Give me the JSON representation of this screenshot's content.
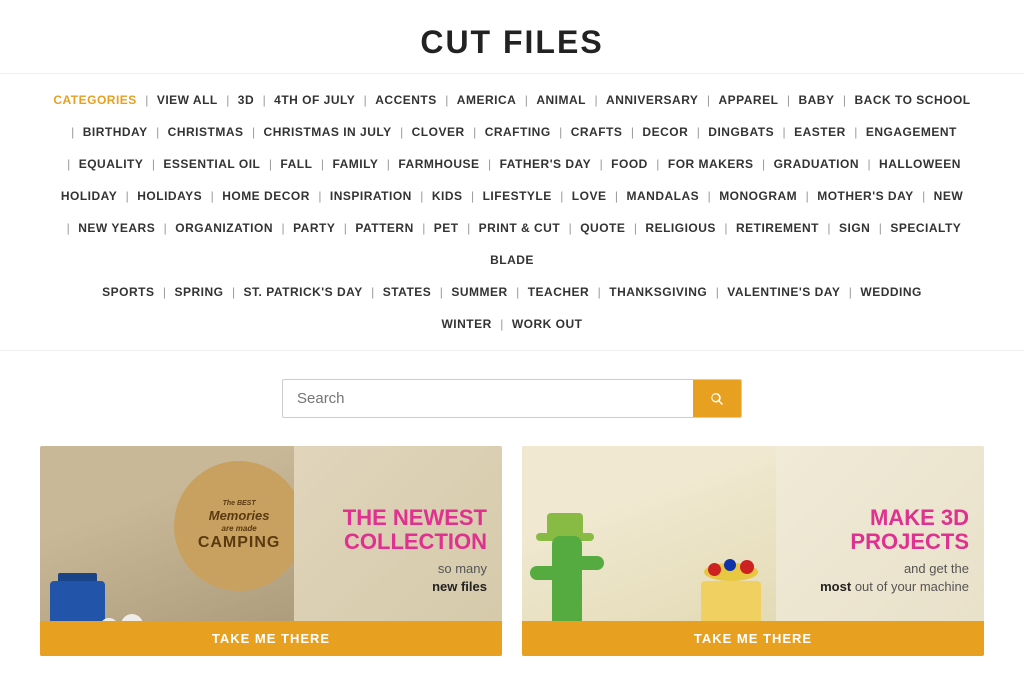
{
  "page": {
    "title": "CUT FILES"
  },
  "search": {
    "placeholder": "Search",
    "button_label": "Search"
  },
  "nav": {
    "items": [
      {
        "label": "CATEGORIES",
        "highlight": true
      },
      {
        "label": "VIEW ALL"
      },
      {
        "label": "3D"
      },
      {
        "label": "4TH OF JULY"
      },
      {
        "label": "ACCENTS"
      },
      {
        "label": "AMERICA"
      },
      {
        "label": "ANIMAL"
      },
      {
        "label": "ANNIVERSARY"
      },
      {
        "label": "APPAREL"
      },
      {
        "label": "BABY"
      },
      {
        "label": "BACK TO SCHOOL"
      },
      {
        "label": "BIRTHDAY"
      },
      {
        "label": "CHRISTMAS"
      },
      {
        "label": "CHRISTMAS IN JULY"
      },
      {
        "label": "CLOVER"
      },
      {
        "label": "CRAFTING"
      },
      {
        "label": "CRAFTS"
      },
      {
        "label": "DECOR"
      },
      {
        "label": "DINGBATS"
      },
      {
        "label": "EASTER"
      },
      {
        "label": "ENGAGEMENT"
      },
      {
        "label": "EQUALITY"
      },
      {
        "label": "ESSENTIAL OIL"
      },
      {
        "label": "FALL"
      },
      {
        "label": "FAMILY"
      },
      {
        "label": "FARMHOUSE"
      },
      {
        "label": "FATHER'S DAY"
      },
      {
        "label": "FOOD"
      },
      {
        "label": "FOR MAKERS"
      },
      {
        "label": "GRADUATION"
      },
      {
        "label": "HALLOWEEN"
      },
      {
        "label": "HOLIDAY"
      },
      {
        "label": "HOLIDAYS"
      },
      {
        "label": "HOME DECOR"
      },
      {
        "label": "INSPIRATION"
      },
      {
        "label": "KIDS"
      },
      {
        "label": "LIFESTYLE"
      },
      {
        "label": "LOVE"
      },
      {
        "label": "MANDALAS"
      },
      {
        "label": "MONOGRAM"
      },
      {
        "label": "MOTHER'S DAY"
      },
      {
        "label": "NEW"
      },
      {
        "label": "NEW YEARS"
      },
      {
        "label": "ORGANIZATION"
      },
      {
        "label": "PARTY"
      },
      {
        "label": "PATTERN"
      },
      {
        "label": "PET"
      },
      {
        "label": "PRINT & CUT"
      },
      {
        "label": "QUOTE"
      },
      {
        "label": "RELIGIOUS"
      },
      {
        "label": "RETIREMENT"
      },
      {
        "label": "SIGN"
      },
      {
        "label": "SPECIALTY BLADE"
      },
      {
        "label": "SPORTS"
      },
      {
        "label": "SPRING"
      },
      {
        "label": "ST. PATRICK'S DAY"
      },
      {
        "label": "STATES"
      },
      {
        "label": "SUMMER"
      },
      {
        "label": "TEACHER"
      },
      {
        "label": "THANKSGIVING"
      },
      {
        "label": "VALENTINE'S DAY"
      },
      {
        "label": "WEDDING"
      },
      {
        "label": "WINTER"
      },
      {
        "label": "WORK OUT"
      }
    ]
  },
  "cards": {
    "left": {
      "heading_line1": "THE NEWEST",
      "heading_line2": "COLLECTION",
      "subtext_line1": "so many",
      "subtext_bold": "new files",
      "button": "TAKE ME THERE"
    },
    "right": {
      "heading_line1": "MAKE 3D",
      "heading_line2": "PROJECTS",
      "subtext_pre": "and get the",
      "subtext_bold": "most",
      "subtext_post": "out of your machine",
      "button": "TAKE ME THERE"
    }
  }
}
